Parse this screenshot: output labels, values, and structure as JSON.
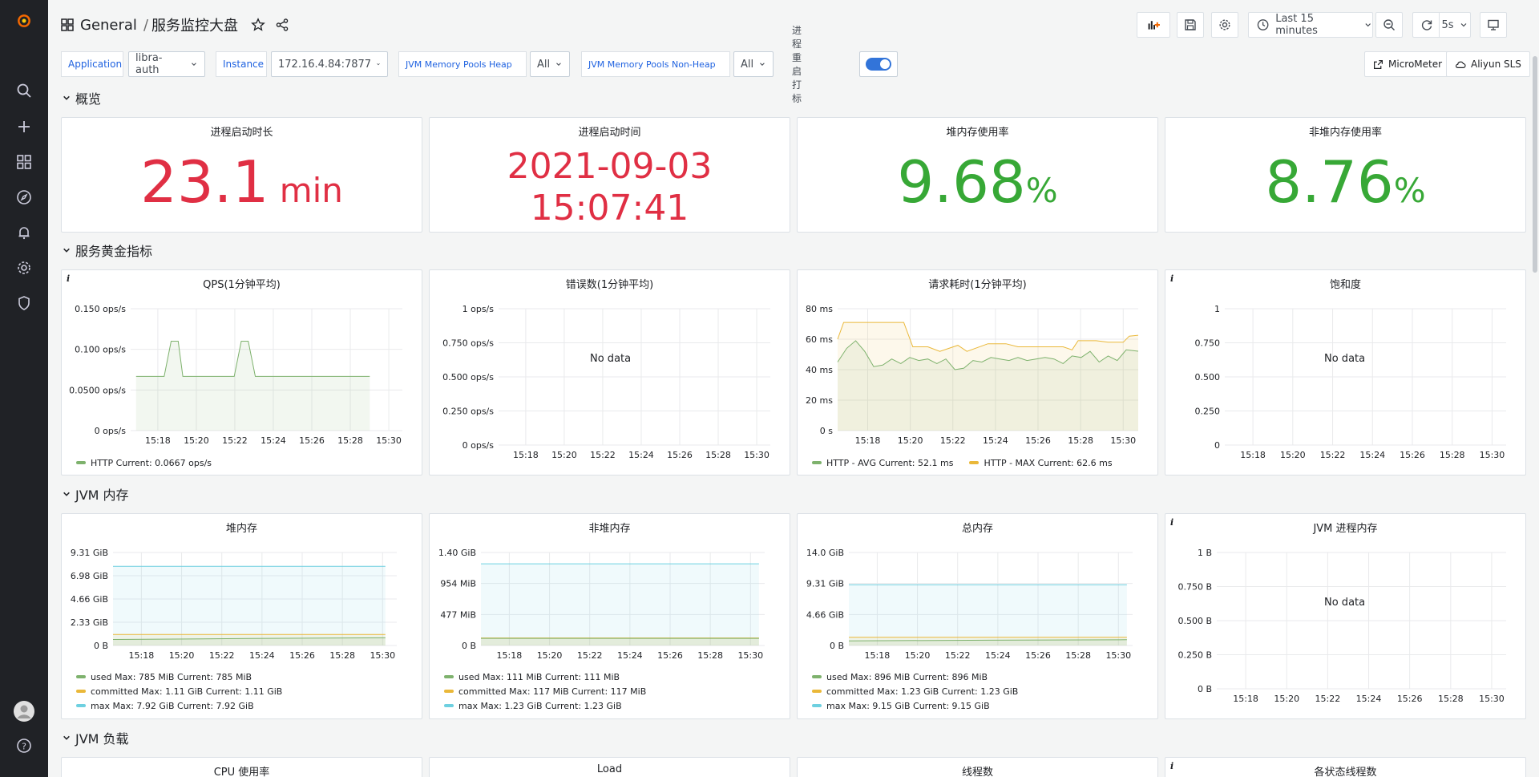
{
  "header": {
    "folder": "General",
    "separator": "/",
    "dashboard": "服务监控大盘",
    "time_range": "Last 15 minutes",
    "refresh": "5s"
  },
  "variables": {
    "application_label": "Application",
    "application_value": "libra-auth",
    "instance_label": "Instance",
    "instance_value": "172.16.4.84:7877",
    "heap_label": "JVM Memory Pools Heap",
    "heap_value": "All",
    "nonheap_label": "JVM Memory Pools Non-Heap",
    "nonheap_value": "All",
    "restart_label": "进程重启打标"
  },
  "links": {
    "micrometer": "MicroMeter",
    "aliyun": "Aliyun SLS"
  },
  "rows": {
    "overview": "概览",
    "golden": "服务黄金指标",
    "jvm_mem": "JVM 内存",
    "jvm_load": "JVM 负载"
  },
  "stats": [
    {
      "title": "进程启动时长",
      "value": "23.1",
      "unit": " min",
      "color": "#e02f44"
    },
    {
      "title": "进程启动时间",
      "line1": "2021-09-03",
      "line2": "15:07:41",
      "color": "#e02f44"
    },
    {
      "title": "堆内存使用率",
      "value": "9.68",
      "unit": "%",
      "color": "#37a836"
    },
    {
      "title": "非堆内存使用率",
      "value": "8.76",
      "unit": "%",
      "color": "#37a836"
    }
  ],
  "golden_panels": {
    "qps_title": "QPS(1分钟平均)",
    "errors_title": "错误数(1分钟平均)",
    "latency_title": "请求耗时(1分钟平均)",
    "saturation_title": "饱和度",
    "no_data": "No data",
    "qps_legend": "HTTP  Current: 0.0667 ops/s",
    "lat_legend_avg": "HTTP - AVG  Current: 52.1 ms",
    "lat_legend_max": "HTTP - MAX  Current: 62.6 ms"
  },
  "mem_panels": {
    "heap_title": "堆内存",
    "nonheap_title": "非堆内存",
    "total_title": "总内存",
    "proc_title": "JVM 进程内存",
    "heap_legend": [
      "used  Max: 785 MiB  Current: 785 MiB",
      "committed  Max: 1.11 GiB  Current: 1.11 GiB",
      "max  Max: 7.92 GiB  Current: 7.92 GiB"
    ],
    "nonheap_legend": [
      "used  Max: 111 MiB  Current: 111 MiB",
      "committed  Max: 117 MiB  Current: 117 MiB",
      "max  Max: 1.23 GiB  Current: 1.23 GiB"
    ],
    "total_legend": [
      "used  Max: 896 MiB  Current: 896 MiB",
      "committed  Max: 1.23 GiB  Current: 1.23 GiB",
      "max  Max: 9.15 GiB  Current: 9.15 GiB"
    ]
  },
  "load_panels": {
    "cpu_title": "CPU 使用率",
    "load_title": "Load",
    "threads_title": "线程数",
    "thread_states_title": "各状态线程数"
  },
  "colors": {
    "green": "#7eb26d",
    "yellow": "#eab839",
    "cyan": "#6ed0e0",
    "red": "#e02f44",
    "stat_green": "#37a836",
    "accent": "#3274d9"
  },
  "chart_data": [
    {
      "id": "qps",
      "type": "line",
      "title": "QPS(1分钟平均)",
      "yticks": [
        "0.150 ops/s",
        "0.100 ops/s",
        "0.0500 ops/s",
        "0 ops/s"
      ],
      "xticks": [
        "15:18",
        "15:20",
        "15:22",
        "15:24",
        "15:26",
        "15:28",
        "15:30"
      ],
      "ylim": [
        0,
        0.15
      ],
      "series": [
        {
          "name": "HTTP",
          "color": "#7eb26d",
          "fill": true,
          "points": [
            [
              0,
              0.0667
            ],
            [
              0.12,
              0.0667
            ],
            [
              0.15,
              0.11
            ],
            [
              0.18,
              0.11
            ],
            [
              0.2,
              0.0667
            ],
            [
              0.42,
              0.0667
            ],
            [
              0.45,
              0.11
            ],
            [
              0.48,
              0.11
            ],
            [
              0.51,
              0.0667
            ],
            [
              1,
              0.0667
            ]
          ]
        }
      ]
    },
    {
      "id": "errors",
      "type": "line",
      "title": "错误数(1分钟平均)",
      "yticks": [
        "1 ops/s",
        "0.750 ops/s",
        "0.500 ops/s",
        "0.250 ops/s",
        "0 ops/s"
      ],
      "xticks": [
        "15:18",
        "15:20",
        "15:22",
        "15:24",
        "15:26",
        "15:28",
        "15:30"
      ],
      "ylim": [
        0,
        1
      ],
      "series": []
    },
    {
      "id": "latency",
      "type": "line",
      "title": "请求耗时(1分钟平均)",
      "yticks": [
        "80 ms",
        "60 ms",
        "40 ms",
        "20 ms",
        "0 s"
      ],
      "xticks": [
        "15:18",
        "15:20",
        "15:22",
        "15:24",
        "15:26",
        "15:28",
        "15:30"
      ],
      "ylim": [
        0,
        80
      ],
      "series": [
        {
          "name": "HTTP - MAX",
          "color": "#eab839",
          "fill": true,
          "points": [
            [
              0,
              60
            ],
            [
              0.02,
              71
            ],
            [
              0.22,
              71
            ],
            [
              0.25,
              55
            ],
            [
              0.3,
              55
            ],
            [
              0.34,
              52
            ],
            [
              0.4,
              56
            ],
            [
              0.43,
              52
            ],
            [
              0.5,
              57
            ],
            [
              0.56,
              57
            ],
            [
              0.6,
              55
            ],
            [
              0.68,
              55
            ],
            [
              0.75,
              55
            ],
            [
              0.78,
              53
            ],
            [
              0.8,
              59
            ],
            [
              0.86,
              59
            ],
            [
              0.9,
              58
            ],
            [
              0.95,
              58
            ],
            [
              0.97,
              62
            ],
            [
              1,
              62.6
            ]
          ]
        },
        {
          "name": "HTTP - AVG",
          "color": "#7eb26d",
          "fill": true,
          "points": [
            [
              0,
              45
            ],
            [
              0.03,
              54
            ],
            [
              0.06,
              59
            ],
            [
              0.09,
              52
            ],
            [
              0.12,
              42
            ],
            [
              0.15,
              43
            ],
            [
              0.18,
              47
            ],
            [
              0.21,
              44
            ],
            [
              0.24,
              48
            ],
            [
              0.27,
              46
            ],
            [
              0.3,
              47
            ],
            [
              0.33,
              44
            ],
            [
              0.36,
              47
            ],
            [
              0.39,
              40
            ],
            [
              0.42,
              41
            ],
            [
              0.45,
              46
            ],
            [
              0.48,
              45
            ],
            [
              0.51,
              48
            ],
            [
              0.54,
              47
            ],
            [
              0.57,
              46
            ],
            [
              0.6,
              48
            ],
            [
              0.63,
              46
            ],
            [
              0.66,
              47
            ],
            [
              0.69,
              48
            ],
            [
              0.72,
              47
            ],
            [
              0.75,
              44
            ],
            [
              0.78,
              49
            ],
            [
              0.81,
              48
            ],
            [
              0.84,
              52
            ],
            [
              0.87,
              45
            ],
            [
              0.9,
              49
            ],
            [
              0.93,
              46
            ],
            [
              0.96,
              53
            ],
            [
              1,
              52.1
            ]
          ]
        }
      ]
    },
    {
      "id": "saturation",
      "type": "line",
      "title": "饱和度",
      "yticks": [
        "1",
        "0.750",
        "0.500",
        "0.250",
        "0"
      ],
      "xticks": [
        "15:18",
        "15:20",
        "15:22",
        "15:24",
        "15:26",
        "15:28",
        "15:30"
      ],
      "ylim": [
        0,
        1
      ],
      "series": []
    },
    {
      "id": "heap",
      "type": "line",
      "title": "堆内存",
      "yticks": [
        "9.31 GiB",
        "6.98 GiB",
        "4.66 GiB",
        "2.33 GiB",
        "0 B"
      ],
      "xticks": [
        "15:18",
        "15:20",
        "15:22",
        "15:24",
        "15:26",
        "15:28",
        "15:30"
      ],
      "ylim": [
        0,
        9.31
      ],
      "series": [
        {
          "name": "max",
          "color": "#6ed0e0",
          "fill": true,
          "points": [
            [
              0,
              7.92
            ],
            [
              1,
              7.92
            ]
          ]
        },
        {
          "name": "committed",
          "color": "#eab839",
          "fill": true,
          "points": [
            [
              0,
              1.11
            ],
            [
              1,
              1.11
            ]
          ]
        },
        {
          "name": "used",
          "color": "#7eb26d",
          "fill": true,
          "points": [
            [
              0,
              0.6
            ],
            [
              0.5,
              0.7
            ],
            [
              1,
              0.77
            ]
          ]
        }
      ]
    },
    {
      "id": "nonheap",
      "type": "line",
      "title": "非堆内存",
      "yticks": [
        "1.40 GiB",
        "954 MiB",
        "477 MiB",
        "0 B"
      ],
      "xticks": [
        "15:18",
        "15:20",
        "15:22",
        "15:24",
        "15:26",
        "15:28",
        "15:30"
      ],
      "ylim": [
        0,
        1.4
      ],
      "series": [
        {
          "name": "max",
          "color": "#6ed0e0",
          "fill": true,
          "points": [
            [
              0,
              1.23
            ],
            [
              1,
              1.23
            ]
          ]
        },
        {
          "name": "committed",
          "color": "#eab839",
          "fill": true,
          "points": [
            [
              0,
              0.114
            ],
            [
              1,
              0.114
            ]
          ]
        },
        {
          "name": "used",
          "color": "#7eb26d",
          "fill": true,
          "points": [
            [
              0,
              0.108
            ],
            [
              1,
              0.108
            ]
          ]
        }
      ]
    },
    {
      "id": "total",
      "type": "line",
      "title": "总内存",
      "yticks": [
        "14.0 GiB",
        "9.31 GiB",
        "4.66 GiB",
        "0 B"
      ],
      "xticks": [
        "15:18",
        "15:20",
        "15:22",
        "15:24",
        "15:26",
        "15:28",
        "15:30"
      ],
      "ylim": [
        0,
        14
      ],
      "series": [
        {
          "name": "max",
          "color": "#6ed0e0",
          "fill": true,
          "points": [
            [
              0,
              9.15
            ],
            [
              1,
              9.15
            ]
          ]
        },
        {
          "name": "committed",
          "color": "#eab839",
          "fill": true,
          "points": [
            [
              0,
              1.23
            ],
            [
              1,
              1.23
            ]
          ]
        },
        {
          "name": "used",
          "color": "#7eb26d",
          "fill": true,
          "points": [
            [
              0,
              0.7
            ],
            [
              0.5,
              0.8
            ],
            [
              1,
              0.875
            ]
          ]
        }
      ]
    },
    {
      "id": "proc",
      "type": "line",
      "title": "JVM 进程内存",
      "yticks": [
        "1 B",
        "0.750 B",
        "0.500 B",
        "0.250 B",
        "0 B"
      ],
      "xticks": [
        "15:18",
        "15:20",
        "15:22",
        "15:24",
        "15:26",
        "15:28",
        "15:30"
      ],
      "ylim": [
        0,
        1
      ],
      "series": []
    }
  ]
}
